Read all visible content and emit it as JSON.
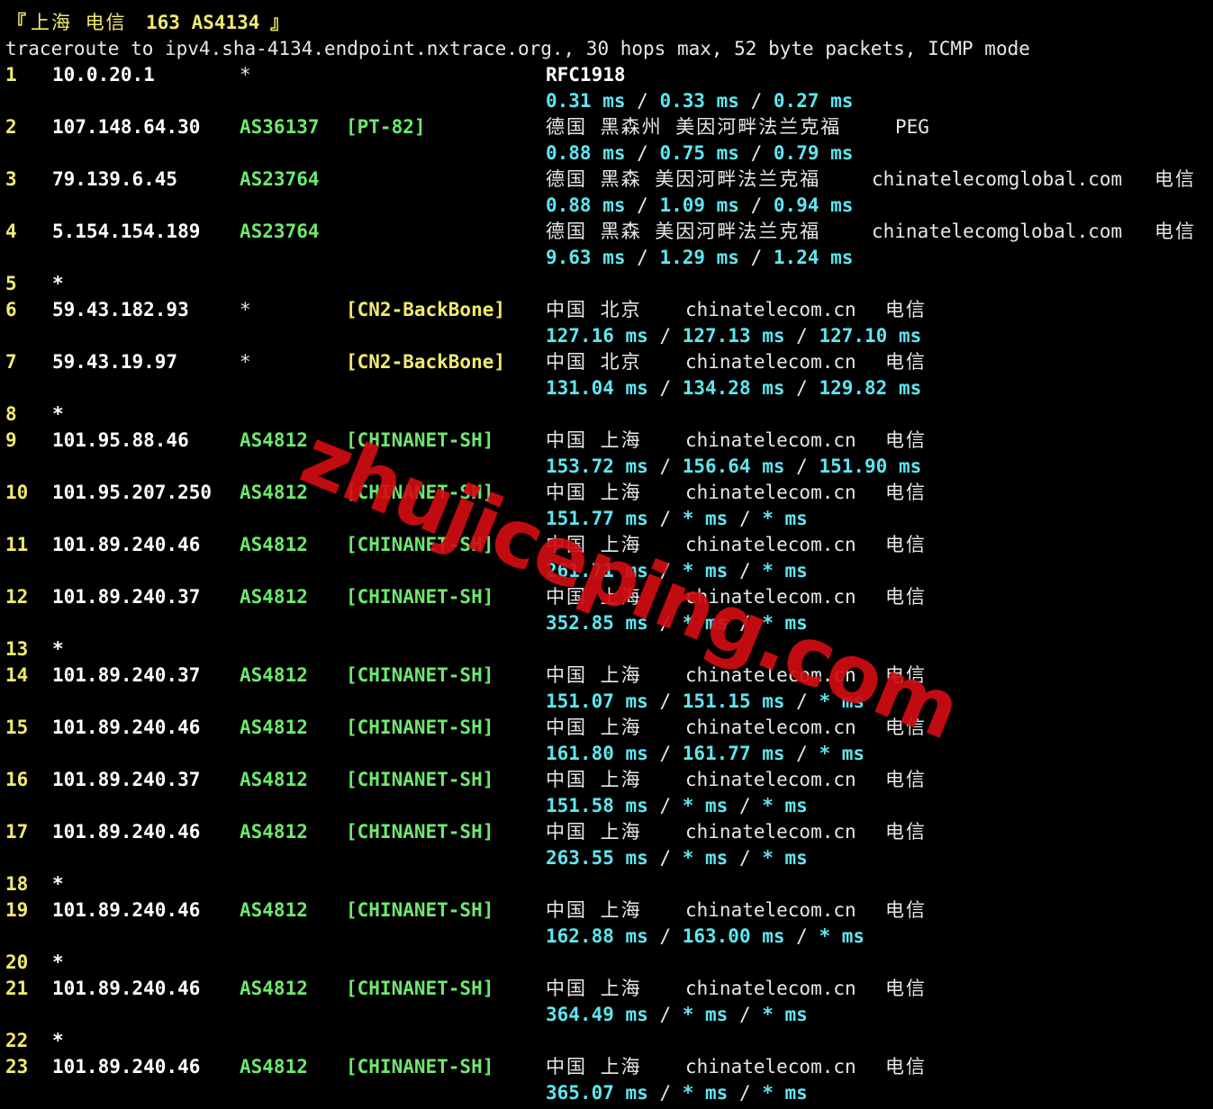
{
  "header": {
    "bracket_open": "『",
    "location": "上海 电信",
    "target": "163 AS4134",
    "bracket_close": "』",
    "command_line": "traceroute to ipv4.sha-4134.endpoint.nxtrace.org., 30 hops max, 52 byte packets, ICMP mode"
  },
  "hops": [
    {
      "hop": "1",
      "ip": "10.0.20.1",
      "asn": "*",
      "tag": "",
      "geo": "RFC1918",
      "domain": "",
      "isp": "",
      "rtt": [
        "0.31 ms",
        "0.33 ms",
        "0.27 ms"
      ]
    },
    {
      "hop": "2",
      "ip": "107.148.64.30",
      "asn": "AS36137",
      "tag": "[PT-82]",
      "geo": "德国 黑森州 美因河畔法兰克福",
      "domain": "PEG",
      "isp": "",
      "rtt": [
        "0.88 ms",
        "0.75 ms",
        "0.79 ms"
      ]
    },
    {
      "hop": "3",
      "ip": "79.139.6.45",
      "asn": "AS23764",
      "tag": "",
      "geo": "德国 黑森 美因河畔法兰克福",
      "domain": "chinatelecomglobal.com",
      "isp": "电信",
      "rtt": [
        "0.88 ms",
        "1.09 ms",
        "0.94 ms"
      ]
    },
    {
      "hop": "4",
      "ip": "5.154.154.189",
      "asn": "AS23764",
      "tag": "",
      "geo": "德国 黑森 美因河畔法兰克福",
      "domain": "chinatelecomglobal.com",
      "isp": "电信",
      "rtt": [
        "9.63 ms",
        "1.29 ms",
        "1.24 ms"
      ]
    },
    {
      "hop": "5",
      "ip": "*"
    },
    {
      "hop": "6",
      "ip": "59.43.182.93",
      "asn": "*",
      "tag": "[CN2-BackBone]",
      "geo": "中国 北京",
      "domain": "chinatelecom.cn",
      "isp": "电信",
      "rtt": [
        "127.16 ms",
        "127.13 ms",
        "127.10 ms"
      ]
    },
    {
      "hop": "7",
      "ip": "59.43.19.97",
      "asn": "*",
      "tag": "[CN2-BackBone]",
      "geo": "中国 北京",
      "domain": "chinatelecom.cn",
      "isp": "电信",
      "rtt": [
        "131.04 ms",
        "134.28 ms",
        "129.82 ms"
      ]
    },
    {
      "hop": "8",
      "ip": "*"
    },
    {
      "hop": "9",
      "ip": "101.95.88.46",
      "asn": "AS4812",
      "tag": "[CHINANET-SH]",
      "geo": "中国 上海",
      "domain": "chinatelecom.cn",
      "isp": "电信",
      "rtt": [
        "153.72 ms",
        "156.64 ms",
        "151.90 ms"
      ]
    },
    {
      "hop": "10",
      "ip": "101.95.207.250",
      "asn": "AS4812",
      "tag": "[CHINANET-SH]",
      "geo": "中国 上海",
      "domain": "chinatelecom.cn",
      "isp": "电信",
      "rtt": [
        "151.77 ms",
        "* ms",
        "* ms"
      ]
    },
    {
      "hop": "11",
      "ip": "101.89.240.46",
      "asn": "AS4812",
      "tag": "[CHINANET-SH]",
      "geo": "中国 上海",
      "domain": "chinatelecom.cn",
      "isp": "电信",
      "rtt": [
        "261.71 ms",
        "* ms",
        "* ms"
      ]
    },
    {
      "hop": "12",
      "ip": "101.89.240.37",
      "asn": "AS4812",
      "tag": "[CHINANET-SH]",
      "geo": "中国 上海",
      "domain": "chinatelecom.cn",
      "isp": "电信",
      "rtt": [
        "352.85 ms",
        "* ms",
        "* ms"
      ]
    },
    {
      "hop": "13",
      "ip": "*"
    },
    {
      "hop": "14",
      "ip": "101.89.240.37",
      "asn": "AS4812",
      "tag": "[CHINANET-SH]",
      "geo": "中国 上海",
      "domain": "chinatelecom.cn",
      "isp": "电信",
      "rtt": [
        "151.07 ms",
        "151.15 ms",
        "* ms"
      ]
    },
    {
      "hop": "15",
      "ip": "101.89.240.46",
      "asn": "AS4812",
      "tag": "[CHINANET-SH]",
      "geo": "中国 上海",
      "domain": "chinatelecom.cn",
      "isp": "电信",
      "rtt": [
        "161.80 ms",
        "161.77 ms",
        "* ms"
      ]
    },
    {
      "hop": "16",
      "ip": "101.89.240.37",
      "asn": "AS4812",
      "tag": "[CHINANET-SH]",
      "geo": "中国 上海",
      "domain": "chinatelecom.cn",
      "isp": "电信",
      "rtt": [
        "151.58 ms",
        "* ms",
        "* ms"
      ]
    },
    {
      "hop": "17",
      "ip": "101.89.240.46",
      "asn": "AS4812",
      "tag": "[CHINANET-SH]",
      "geo": "中国 上海",
      "domain": "chinatelecom.cn",
      "isp": "电信",
      "rtt": [
        "263.55 ms",
        "* ms",
        "* ms"
      ]
    },
    {
      "hop": "18",
      "ip": "*"
    },
    {
      "hop": "19",
      "ip": "101.89.240.46",
      "asn": "AS4812",
      "tag": "[CHINANET-SH]",
      "geo": "中国 上海",
      "domain": "chinatelecom.cn",
      "isp": "电信",
      "rtt": [
        "162.88 ms",
        "163.00 ms",
        "* ms"
      ]
    },
    {
      "hop": "20",
      "ip": "*"
    },
    {
      "hop": "21",
      "ip": "101.89.240.46",
      "asn": "AS4812",
      "tag": "[CHINANET-SH]",
      "geo": "中国 上海",
      "domain": "chinatelecom.cn",
      "isp": "电信",
      "rtt": [
        "364.49 ms",
        "* ms",
        "* ms"
      ]
    },
    {
      "hop": "22",
      "ip": "*"
    },
    {
      "hop": "23",
      "ip": "101.89.240.46",
      "asn": "AS4812",
      "tag": "[CHINANET-SH]",
      "geo": "中国 上海",
      "domain": "chinatelecom.cn",
      "isp": "电信",
      "rtt": [
        "365.07 ms",
        "* ms",
        "* ms"
      ]
    }
  ],
  "rtt_separator": " / ",
  "watermark": "zhujiceping.com"
}
